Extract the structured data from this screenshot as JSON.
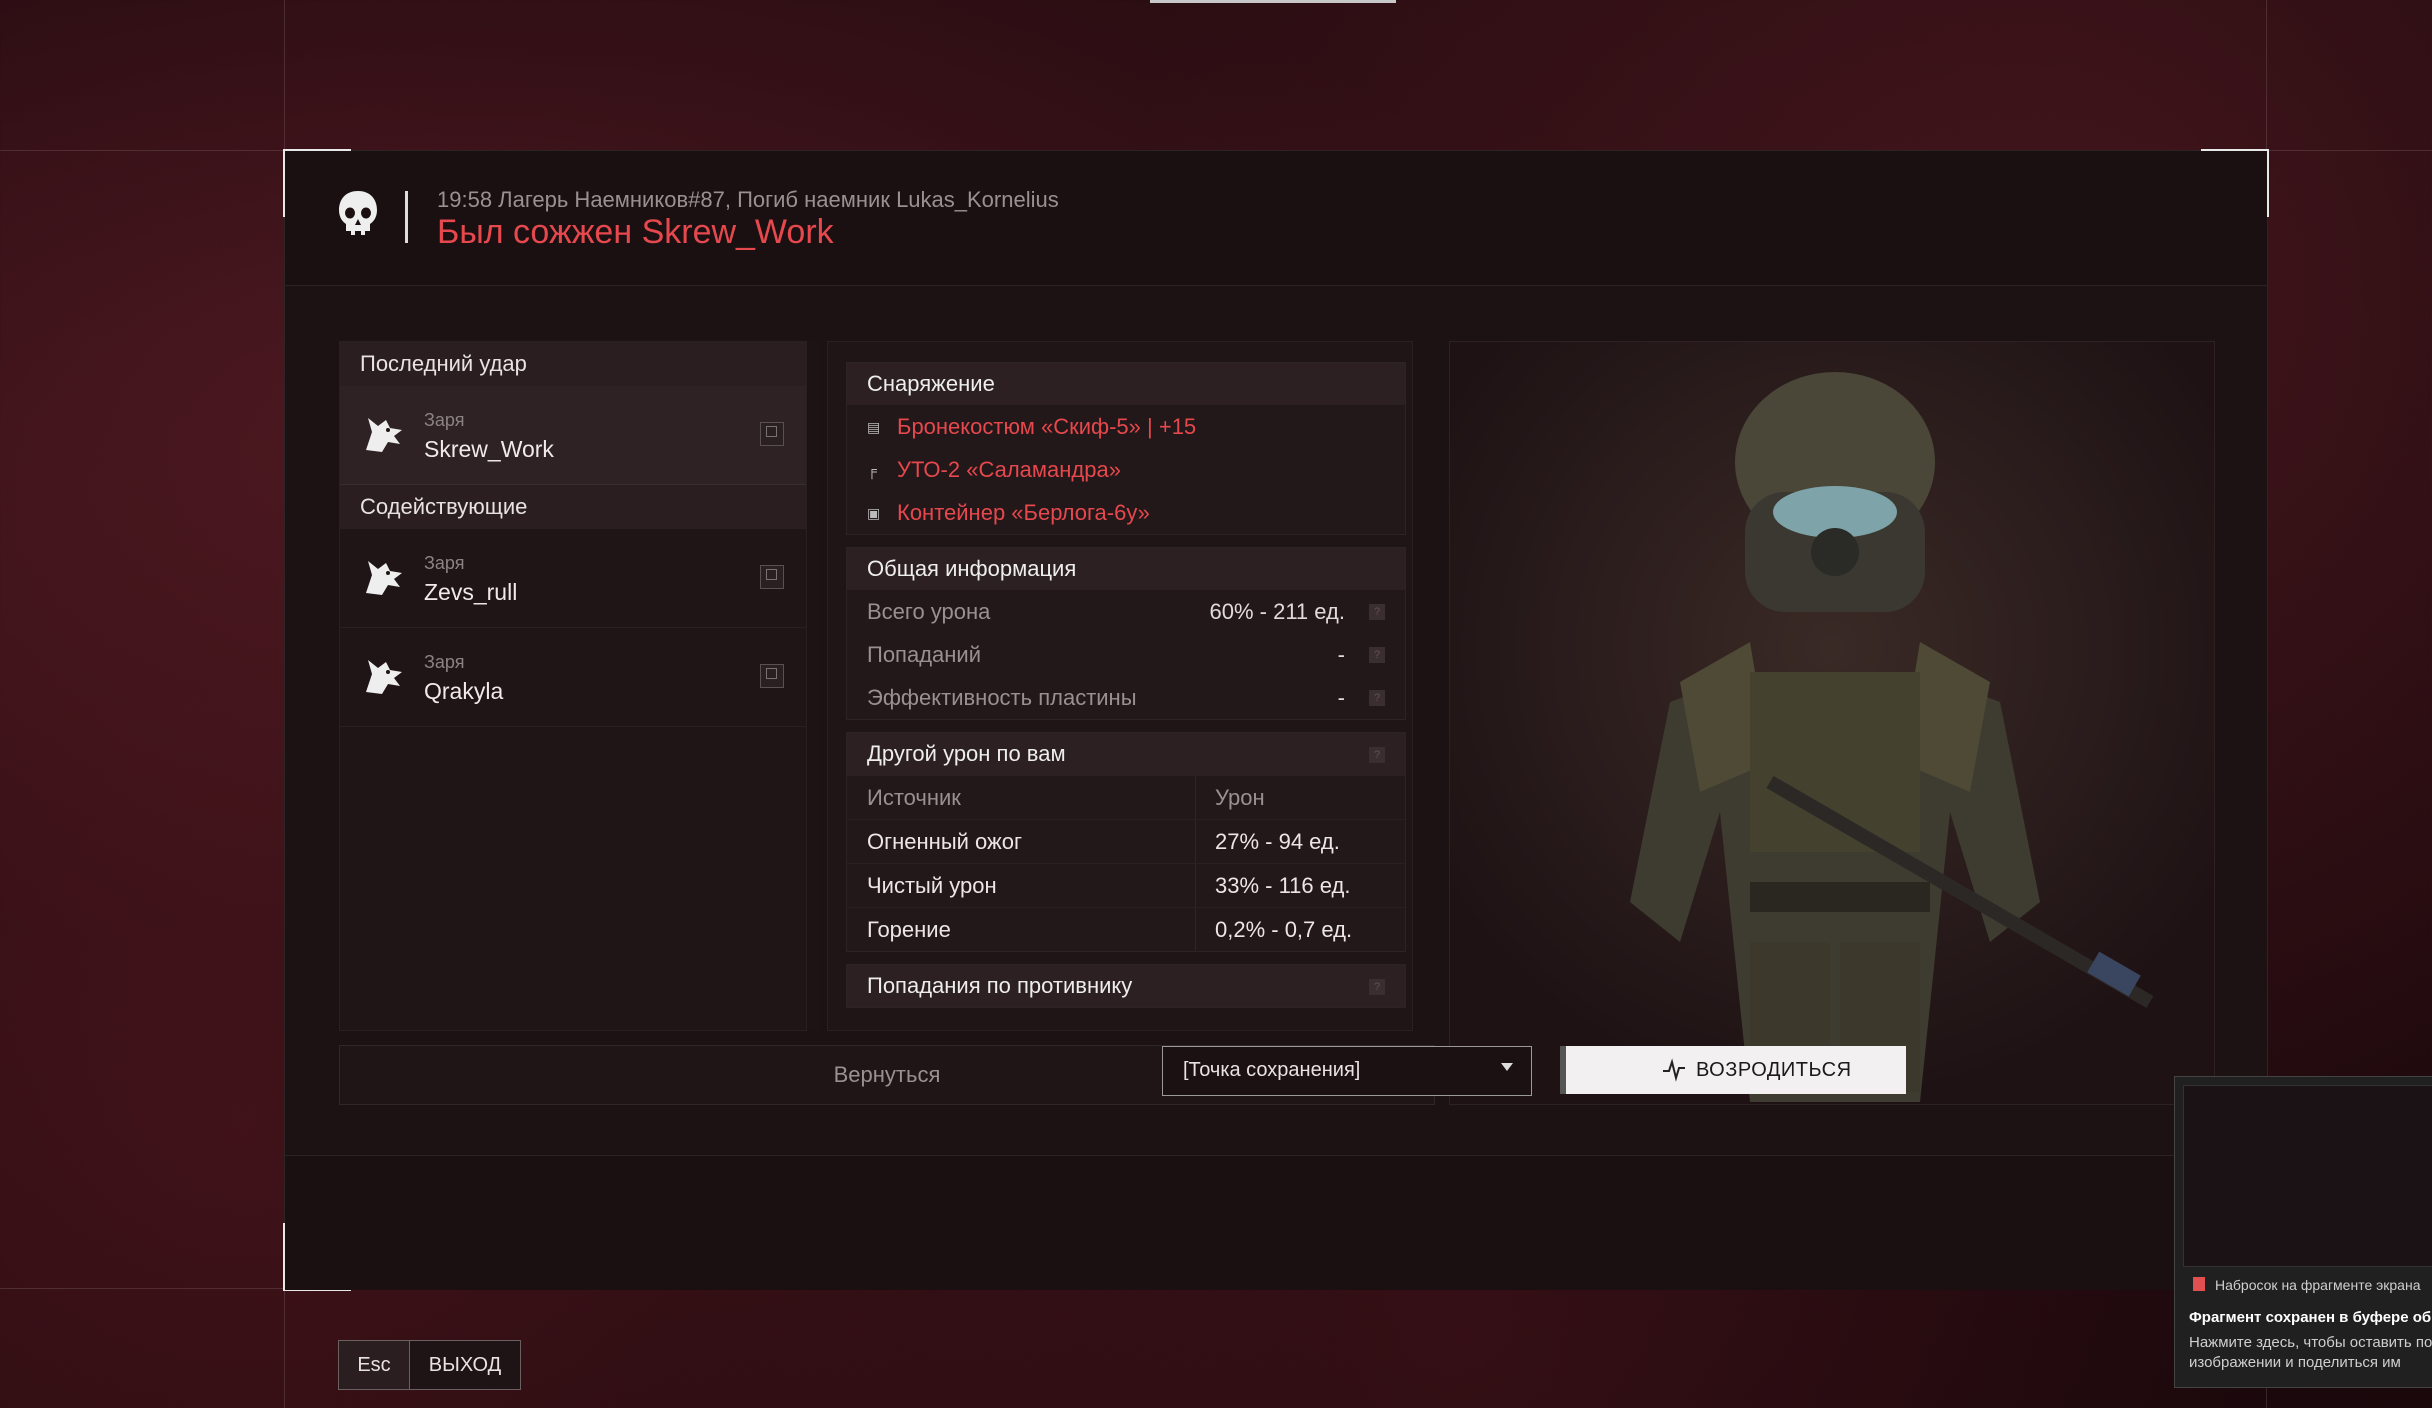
{
  "header": {
    "subtitle": "19:58 Лагерь Наемников#87, Погиб наемник Lukas_Kornelius",
    "title": "Был сожжен Skrew_Work"
  },
  "killers": {
    "last_hit_label": "Последний удар",
    "last_hit": {
      "faction": "Заря",
      "name": "Skrew_Work"
    },
    "assist_label": "Содействующие",
    "assists": [
      {
        "faction": "Заря",
        "name": "Zevs_rull"
      },
      {
        "faction": "Заря",
        "name": "Qrakyla"
      }
    ]
  },
  "equipment": {
    "label": "Снаряжение",
    "items": [
      {
        "icon": "armor-icon",
        "name": "Бронекостюм «Скиф-5» | +15"
      },
      {
        "icon": "weapon-icon",
        "name": "УТО-2 «Саламандра»"
      },
      {
        "icon": "container-icon",
        "name": "Контейнер «Берлога-6у»"
      }
    ]
  },
  "general": {
    "label": "Общая информация",
    "rows": [
      {
        "label": "Всего урона",
        "value": "60% - 211 ед."
      },
      {
        "label": "Попаданий",
        "value": "-"
      },
      {
        "label": "Эффективность пластины",
        "value": "-"
      }
    ]
  },
  "other_damage": {
    "label": "Другой урон по вам",
    "col_source": "Источник",
    "col_damage": "Урон",
    "rows": [
      {
        "source": "Огненный ожог",
        "damage": "27% - 94 ед."
      },
      {
        "source": "Чистый урон",
        "damage": "33% - 116 ед."
      },
      {
        "source": "Горение",
        "damage": "0,2% - 0,7 ед."
      }
    ]
  },
  "enemy_hits": {
    "label": "Попадания по противнику"
  },
  "back_label": "Вернуться",
  "footer": {
    "spawn_point": "[Точка сохранения]",
    "respawn_label": "ВОЗРОДИТЬСЯ"
  },
  "exit": {
    "key": "Esc",
    "label": "ВЫХОД"
  },
  "toast": {
    "app": "Набросок на фрагменте экрана",
    "title": "Фрагмент сохранен в буфере обм",
    "body": "Нажмите здесь, чтобы оставить по изображении и поделиться им"
  },
  "colors": {
    "accent": "#e5484d",
    "panel": "#1c1214"
  }
}
